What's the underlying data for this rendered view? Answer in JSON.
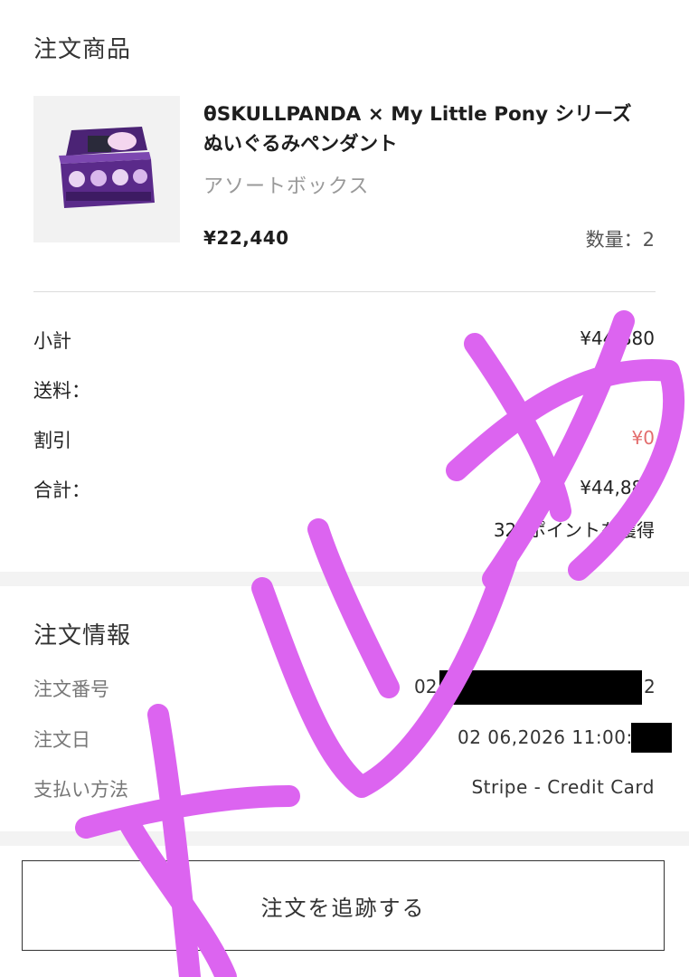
{
  "order_items": {
    "title": "注文商品",
    "product": {
      "name": "θSKULLPANDA × My Little Pony シリーズ ぬいぐるみペンダント",
      "variant": "アソートボックス",
      "price": "¥22,440",
      "quantity": "数量：2"
    }
  },
  "summary": {
    "subtotal_label": "小計",
    "subtotal_value": "¥44,880",
    "shipping_label": "送料：",
    "discount_label": "割引",
    "discount_value": "¥0",
    "total_label": "合計：",
    "total_value": "¥44,880",
    "points": "320ポイントを獲得"
  },
  "order_info": {
    "title": "注文情報",
    "number_label": "注文番号",
    "number_prefix": "02",
    "number_suffix": "2",
    "date_label": "注文日",
    "date_value": "02 06,2026 11:00:",
    "payment_label": "支払い方法",
    "payment_value": "Stripe - Credit Card"
  },
  "actions": {
    "track_button": "注文を追跡する"
  },
  "overlay": {
    "watermark_text": "メルカリ",
    "color": "#dc64f0"
  },
  "colors": {
    "discount_red": "#e36d6d",
    "redaction": "#000000"
  }
}
